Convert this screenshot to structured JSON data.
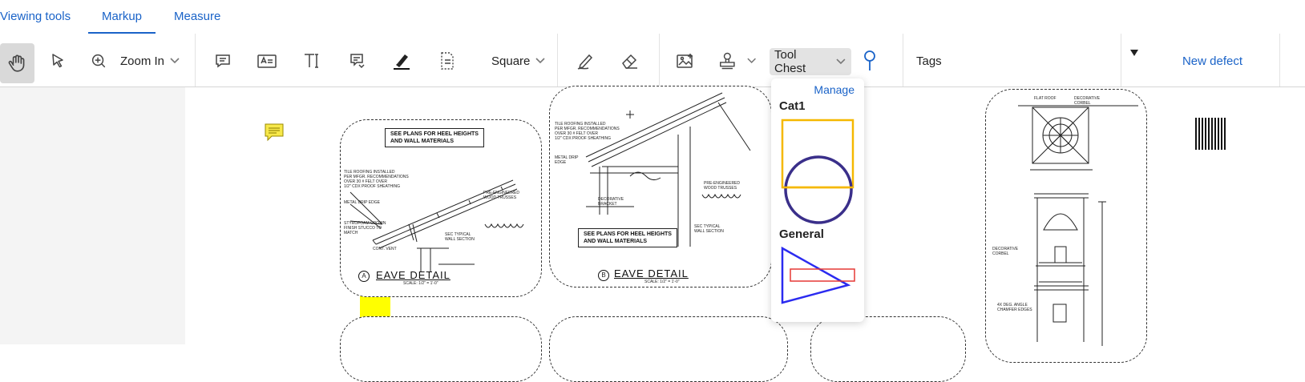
{
  "tabs": [
    {
      "label": "Viewing tools"
    },
    {
      "label": "Markup"
    },
    {
      "label": "Measure"
    }
  ],
  "toolbar": {
    "zoom_label": "Zoom In",
    "shape_label": "Square",
    "toolchest_label": "Tool Chest",
    "tags_label": "Tags",
    "new_defect_label": "New defect"
  },
  "icons": [
    "pan-hand-icon",
    "select-arrow-icon",
    "zoom-in-icon",
    "comment-icon",
    "text-box-icon",
    "text-tool-icon",
    "callout-icon",
    "highlighter-icon",
    "stamp-area-icon",
    "pen-icon",
    "eraser-icon",
    "image-icon",
    "stamp-icon",
    "location-pin-icon",
    "dropdown-triangle-icon"
  ],
  "toolchest_popup": {
    "manage_label": "Manage",
    "categories": [
      {
        "name": "Cat1"
      },
      {
        "name": "General"
      }
    ]
  },
  "drawing": {
    "detail_a_title": "EAVE  DETAIL",
    "detail_a_letter": "A",
    "detail_b_title": "EAVE  DETAIL",
    "detail_b_letter": "B",
    "note_a": "SEE PLANS FOR HEEL HEIGHTS\nAND WALL MATERIALS",
    "note_b": "SEE PLANS FOR HEEL HEIGHTS\nAND WALL MATERIALS",
    "scale_text": "SCALE: 1/2\" = 1'-0\""
  },
  "colors": {
    "accent": "#1a63c8",
    "highlight_yellow": "#ffff00",
    "tool_orange": "#f5b800",
    "tool_circle": "#3a2f8a",
    "tool_triangle_blue": "#2b2bf0",
    "tool_rect_red": "#e53935"
  }
}
